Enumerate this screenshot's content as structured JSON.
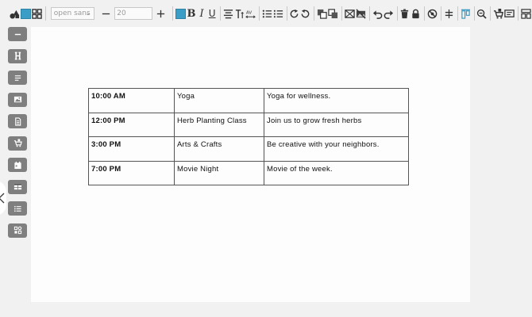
{
  "toolbar": {
    "font_family_value": "open sans",
    "font_size_value": "20",
    "fill_color": "#3a9ec6",
    "text_color": "#3a9ec6",
    "bold_label": "B",
    "italic_label": "I",
    "underline_label": "U",
    "minus_label": "—",
    "plus_label": "+",
    "kerning_label": "AV"
  },
  "sidebar": {
    "items": [
      {
        "icon": "divider-icon"
      },
      {
        "icon": "heading-icon"
      },
      {
        "icon": "paragraph-icon"
      },
      {
        "icon": "image-icon"
      },
      {
        "icon": "document-icon"
      },
      {
        "icon": "cart-icon"
      },
      {
        "icon": "calendar-icon"
      },
      {
        "icon": "table-icon"
      },
      {
        "icon": "list-icon"
      },
      {
        "icon": "widgets-icon"
      }
    ]
  },
  "table": {
    "rows": [
      {
        "time": "10:00 AM",
        "activity": "Yoga",
        "description": "Yoga for wellness."
      },
      {
        "time": "12:00 PM",
        "activity": "Herb Planting Class",
        "description": "Join us to grow fresh herbs"
      },
      {
        "time": "3:00 PM",
        "activity": "Arts & Crafts",
        "description": "Be creative with your neighbors."
      },
      {
        "time": "7:00 PM",
        "activity": "Movie Night",
        "description": "Movie of the week."
      }
    ]
  },
  "colors": {
    "accent": "#3a9ec6",
    "sidebar_button": "#7f7f7f",
    "canvas": "#fdfdfd",
    "background": "#f1f1f1"
  }
}
